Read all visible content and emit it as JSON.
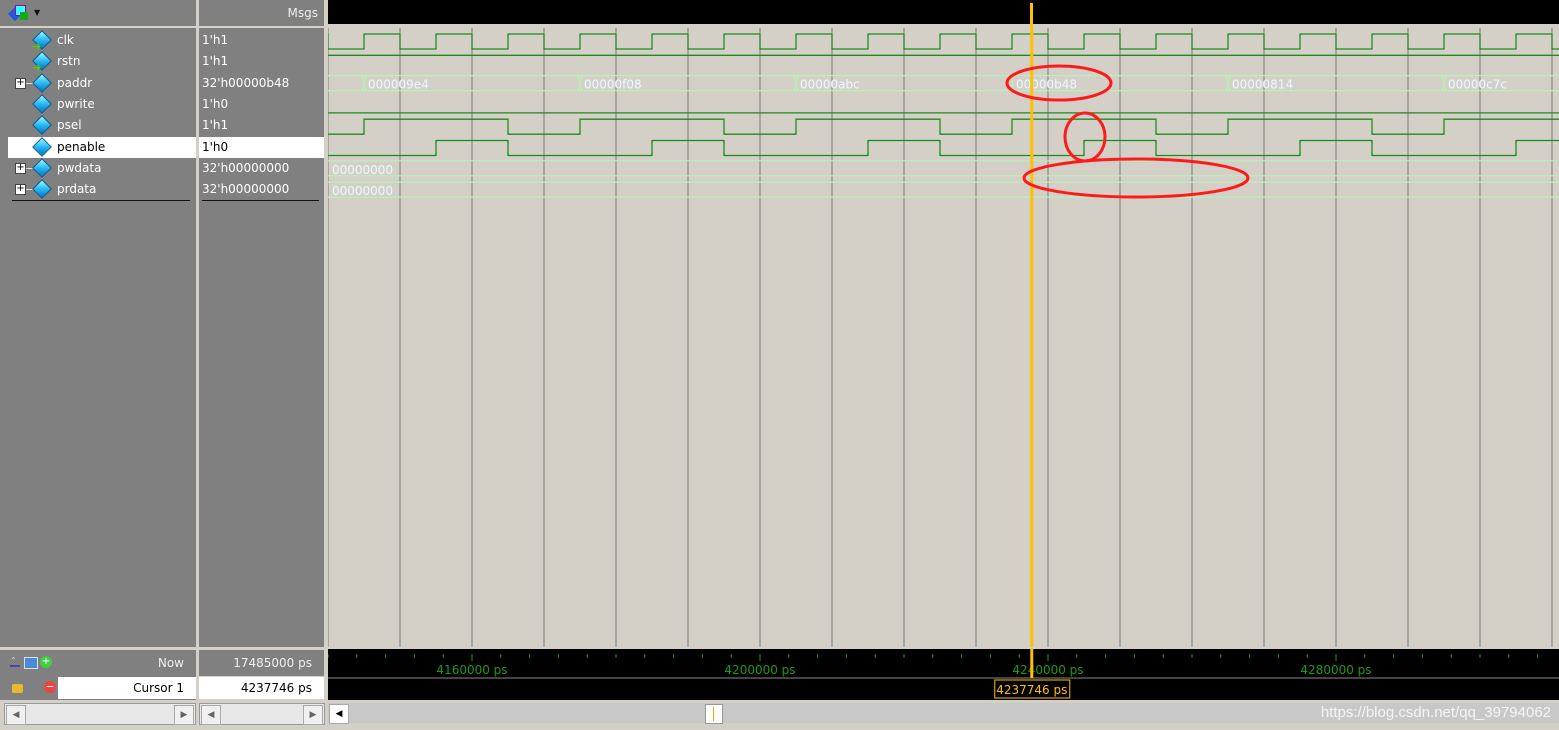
{
  "header": {
    "msgs_label": "Msgs",
    "menu_icon": "wave-layout-icon"
  },
  "signals": [
    {
      "name": "clk",
      "value": "1'h1",
      "icon": "clock-input-icon",
      "expandable": false
    },
    {
      "name": "rstn",
      "value": "1'h1",
      "icon": "input-signal-icon",
      "expandable": false
    },
    {
      "name": "paddr",
      "value": "32'h00000b48",
      "icon": "signal-icon",
      "expandable": true
    },
    {
      "name": "pwrite",
      "value": "1'h0",
      "icon": "signal-icon",
      "expandable": false
    },
    {
      "name": "psel",
      "value": "1'h1",
      "icon": "signal-icon",
      "expandable": false
    },
    {
      "name": "penable",
      "value": "1'h0",
      "icon": "signal-icon",
      "expandable": false,
      "selected": true
    },
    {
      "name": "pwdata",
      "value": "32'h00000000",
      "icon": "signal-icon",
      "expandable": true
    },
    {
      "name": "prdata",
      "value": "32'h00000000",
      "icon": "signal-icon",
      "expandable": true
    }
  ],
  "waves": {
    "clk": {
      "type": "clock",
      "period_ps": 10000,
      "rise_ps": 4145000
    },
    "rstn": {
      "type": "const",
      "level": 1
    },
    "pwrite": {
      "type": "const",
      "level": 0
    },
    "psel": {
      "type": "pulse",
      "period_ps": 30000,
      "high_from_ps": 4145000,
      "high_to_ps": 4165000
    },
    "penable": {
      "type": "pulse",
      "period_ps": 30000,
      "high_from_ps": 4155000,
      "high_to_ps": 4165000
    },
    "paddr": {
      "type": "bus",
      "changes": [
        {
          "t": 4145000,
          "value": "000009e4"
        },
        {
          "t": 4175000,
          "value": "00000f08"
        },
        {
          "t": 4205000,
          "value": "00000abc"
        },
        {
          "t": 4235000,
          "value": "00000b48"
        },
        {
          "t": 4265000,
          "value": "00000814"
        },
        {
          "t": 4295000,
          "value": "00000c7c"
        }
      ]
    },
    "pwdata": {
      "type": "bus",
      "changes": [
        {
          "t": 4140000,
          "value": "00000000"
        }
      ]
    },
    "prdata": {
      "type": "bus",
      "changes": [
        {
          "t": 4140000,
          "value": "00000000"
        }
      ]
    }
  },
  "timeline": {
    "labels": [
      "4160000 ps",
      "4200000 ps",
      "4240000 ps",
      "4280000 ps"
    ],
    "label_times_ps": [
      4160000,
      4200000,
      4240000,
      4280000
    ],
    "grid_step_ps": 10000,
    "minor_tick_ps": 4000
  },
  "footer": {
    "now_label": "Now",
    "now_value": "17485000 ps",
    "cursor_label": "Cursor 1",
    "cursor_value": "4237746 ps",
    "cursor_time_ps": 4237746
  },
  "watermark": "https://blog.csdn.net/qq_39794062",
  "colors": {
    "wave": "#1c8c1c",
    "bus": "#b8f0b8",
    "grid": "#7a7a7a",
    "cursor": "#ffc000",
    "annotation": "#ff1a1a",
    "timeline": "#1a9a1a"
  }
}
